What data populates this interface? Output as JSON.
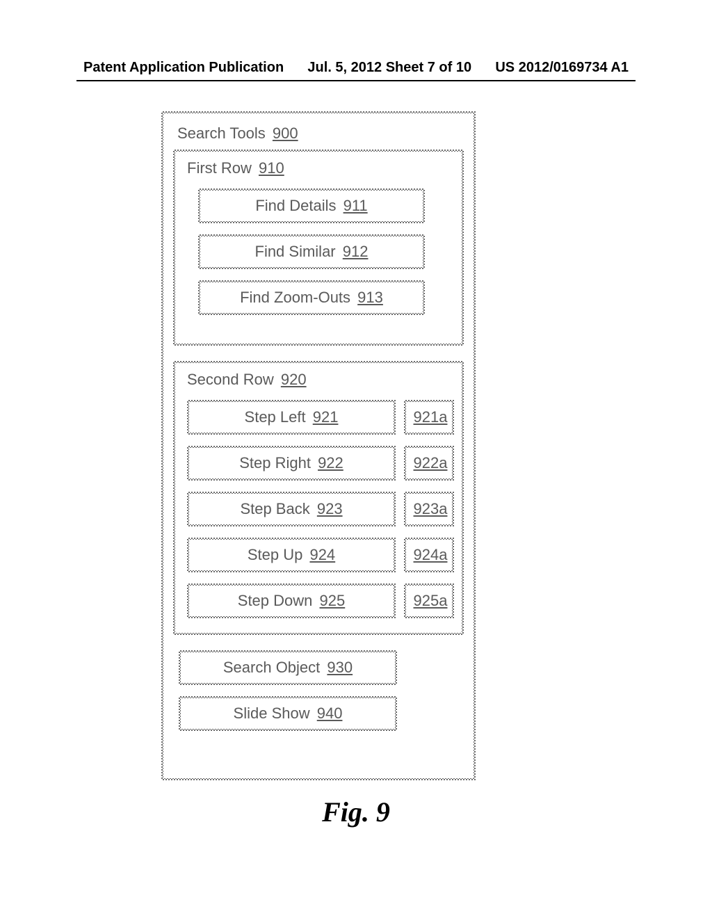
{
  "header": {
    "left": "Patent Application Publication",
    "center": "Jul. 5, 2012  Sheet 7 of 10",
    "right": "US 2012/0169734 A1"
  },
  "panel": {
    "title_text": "Search Tools",
    "title_ref": "900",
    "first_row": {
      "title_text": "First Row",
      "title_ref": "910",
      "items": [
        {
          "label": "Find Details",
          "ref": "911"
        },
        {
          "label": "Find Similar",
          "ref": "912"
        },
        {
          "label": "Find Zoom-Outs",
          "ref": "913"
        }
      ]
    },
    "second_row": {
      "title_text": "Second Row",
      "title_ref": "920",
      "items": [
        {
          "label": "Step Left",
          "ref": "921",
          "side_ref": "921a"
        },
        {
          "label": "Step Right",
          "ref": "922",
          "side_ref": "922a"
        },
        {
          "label": "Step Back",
          "ref": "923",
          "side_ref": "923a"
        },
        {
          "label": "Step Up",
          "ref": "924",
          "side_ref": "924a"
        },
        {
          "label": "Step Down",
          "ref": "925",
          "side_ref": "925a"
        }
      ]
    },
    "search_object": {
      "label": "Search Object",
      "ref": "930"
    },
    "slide_show": {
      "label": "Slide Show",
      "ref": "940"
    }
  },
  "figure_caption": "Fig. 9"
}
